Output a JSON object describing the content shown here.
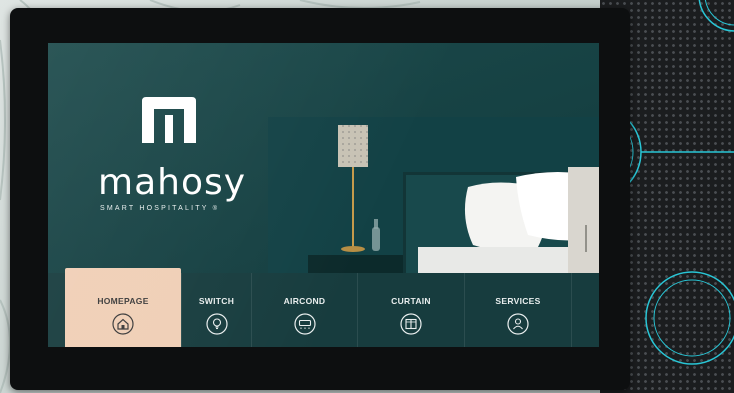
{
  "brand": {
    "name": "mahosy",
    "tagline": "SMART HOSPITALITY",
    "registered_mark": "®"
  },
  "nav": {
    "items": [
      {
        "label": "HOMEPAGE",
        "icon": "home-icon",
        "active": true
      },
      {
        "label": "SWITCH",
        "icon": "lightbulb-icon",
        "active": false
      },
      {
        "label": "AIRCOND",
        "icon": "aircond-icon",
        "active": false
      },
      {
        "label": "CURTAIN",
        "icon": "curtain-icon",
        "active": false
      },
      {
        "label": "SERVICES",
        "icon": "services-icon",
        "active": false
      }
    ]
  },
  "colors": {
    "screen_bg": "#154042",
    "nav_bg": "#173c3e",
    "active_tab": "#f0cfb6",
    "accent_ring": "#29c6d6",
    "bezel": "#0d0f10"
  }
}
